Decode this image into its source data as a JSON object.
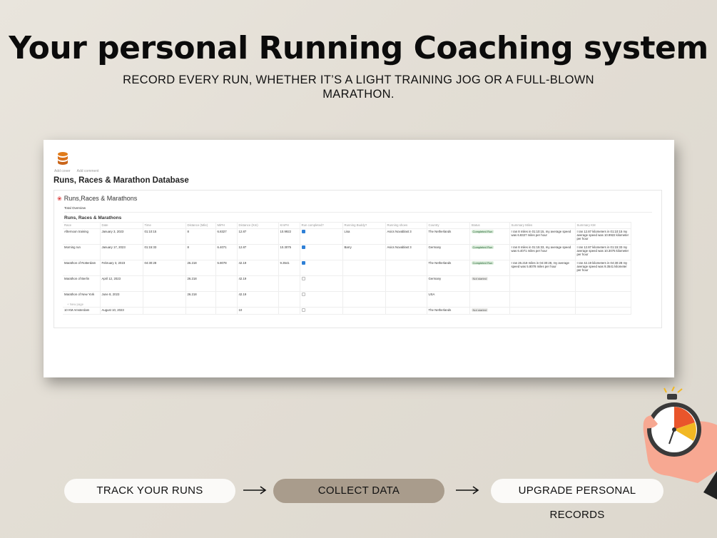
{
  "header": {
    "title": "Your personal Running Coaching system",
    "subtitle": "RECORD EVERY RUN, WHETHER IT’S A LIGHT TRAINING JOG OR A FULL-BLOWN MARATHON."
  },
  "app": {
    "add_cover": "Add cover",
    "add_comment": "Add comment",
    "page_title": "Runs, Races & Marathon Database",
    "db_heading": "Runs,Races & Marathons",
    "tab_label": "Total Overview",
    "table_title": "Runs, Races & Marathons",
    "new_page": "+ New page",
    "columns": [
      "Race",
      "Date",
      "Time",
      "Distance (Mile)",
      "MiPH",
      "Distance (Km)",
      "KmPH",
      "Run completed?",
      "Running Buddy?",
      "Running shoes",
      "Country",
      "Status",
      "Summary Miles",
      "Summary KM"
    ],
    "rows": [
      {
        "race": "Afternoon training",
        "date": "January 3, 2023",
        "time": "01:10:15",
        "dist_mi": "8",
        "miph": "6.8327",
        "dist_km": "12.87",
        "kmph": "10.9922",
        "completed": true,
        "buddy": "Lisa",
        "shoes": "Asics Novablast 3",
        "country": "The Netherlands",
        "status": "Completed Run",
        "summary_mi": "I ran 8 miles in 01:10:15, my average speed was 6.8327 miles per hour",
        "summary_km": "I ran 12.87 kilometers in 01:10:15 my average speed was 10.9922 kilometer per hour"
      },
      {
        "race": "Morning run",
        "date": "January 17, 2023",
        "time": "01:15:33",
        "dist_mi": "8",
        "miph": "6.4071",
        "dist_km": "12.87",
        "kmph": "10.3075",
        "completed": true,
        "buddy": "Barry",
        "shoes": "Asics Novablast 3",
        "country": "Germany",
        "status": "Completed Run",
        "summary_mi": "I ran 8 miles in 01:15:33, my average speed was 6.4071 miles per hour",
        "summary_km": "I ran 12.87 kilometers in 01:15:33 my average speed was 10.3075 kilometer per hour"
      },
      {
        "race": "Marathon of Rotterdam",
        "date": "February 3, 2023",
        "time": "04:30:28",
        "dist_mi": "26.218",
        "miph": "5.8078",
        "dist_km": "42.19",
        "kmph": "9.3541",
        "completed": true,
        "buddy": "",
        "shoes": "",
        "country": "The Netherlands",
        "status": "Completed Run",
        "summary_mi": "I ran 26.218 miles in 04:30:28, my average speed was 5.8078 miles per hour",
        "summary_km": "I ran 42.19 kilometers in 04:30:28 my average speed was 9.3541 kilometer per hour"
      },
      {
        "race": "Marathon of Berlin",
        "date": "April 12, 2023",
        "time": "",
        "dist_mi": "26.218",
        "miph": "",
        "dist_km": "42.19",
        "kmph": "",
        "completed": false,
        "buddy": "",
        "shoes": "",
        "country": "Germany",
        "status": "Not started",
        "summary_mi": "",
        "summary_km": ""
      },
      {
        "race": "Marathon of New York",
        "date": "June 8, 2023",
        "time": "",
        "dist_mi": "26.218",
        "miph": "",
        "dist_km": "42.19",
        "kmph": "",
        "completed": false,
        "buddy": "",
        "shoes": "",
        "country": "USA",
        "status": "",
        "summary_mi": "",
        "summary_km": ""
      },
      {
        "race": "10 KM Amsterdam",
        "date": "August 10, 2023",
        "time": "",
        "dist_mi": "",
        "miph": "",
        "dist_km": "10",
        "kmph": "",
        "completed": false,
        "buddy": "",
        "shoes": "",
        "country": "The Netherlands",
        "status": "Not started",
        "summary_mi": "",
        "summary_km": ""
      }
    ]
  },
  "steps": {
    "step1": "TRACK YOUR RUNS",
    "step2": "COLLECT DATA",
    "step3": "UPGRADE PERSONAL RECORDS"
  },
  "icons": {
    "database": "database-icon",
    "arrow": "arrow-right-icon",
    "stopwatch": "stopwatch-hand-icon"
  },
  "colors": {
    "background": "#e6e2da",
    "active_pill": "#a99c8c",
    "pill": "#fbfaf8",
    "db_icon": "#e07b1a",
    "checkbox": "#2f80d6",
    "completed_tag": "#dbeddb"
  }
}
